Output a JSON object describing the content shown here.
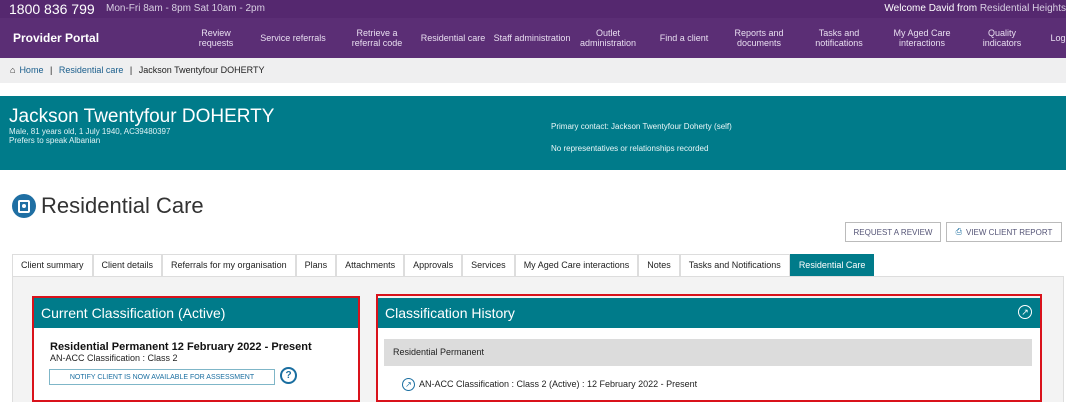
{
  "topbar": {
    "phone": "1800 836 799",
    "hours": "Mon-Fri 8am - 8pm Sat 10am - 2pm",
    "welcome_prefix": "Welcome David from",
    "welcome_org": "Residential Heights"
  },
  "nav": {
    "brand": "Provider Portal",
    "items": [
      {
        "label": "Review requests"
      },
      {
        "label": "Service referrals"
      },
      {
        "label": "Retrieve a referral code"
      },
      {
        "label": "Residential care"
      },
      {
        "label": "Staff administration"
      },
      {
        "label": "Outlet administration"
      },
      {
        "label": "Find a client"
      },
      {
        "label": "Reports and documents"
      },
      {
        "label": "Tasks and notifications"
      },
      {
        "label": "My Aged Care interactions"
      },
      {
        "label": "Quality indicators"
      },
      {
        "label": "Log"
      }
    ]
  },
  "breadcrumb": {
    "home": "Home",
    "sep": "|",
    "residential": "Residential care",
    "current": "Jackson Twentyfour DOHERTY"
  },
  "client": {
    "name": "Jackson Twentyfour DOHERTY",
    "details": "Male, 81 years old, 1 July 1940, AC39480397",
    "language": "Prefers to speak Albanian",
    "primary_contact": "Primary contact: Jackson Twentyfour Doherty (self)",
    "relationships": "No representatives or relationships recorded"
  },
  "page": {
    "title": "Residential Care",
    "request_review": "REQUEST A REVIEW",
    "view_report": "VIEW CLIENT REPORT"
  },
  "tabs": [
    {
      "label": "Client summary"
    },
    {
      "label": "Client details"
    },
    {
      "label": "Referrals for my organisation"
    },
    {
      "label": "Plans"
    },
    {
      "label": "Attachments"
    },
    {
      "label": "Approvals"
    },
    {
      "label": "Services"
    },
    {
      "label": "My Aged Care interactions"
    },
    {
      "label": "Notes"
    },
    {
      "label": "Tasks and Notifications"
    },
    {
      "label": "Residential Care"
    }
  ],
  "current_classification": {
    "heading": "Current Classification (Active)",
    "title": "Residential Permanent 12 February 2022 - Present",
    "classification": "AN-ACC Classification : Class 2",
    "notify_button": "NOTIFY CLIENT IS NOW AVAILABLE FOR ASSESSMENT",
    "help": "?"
  },
  "history": {
    "heading": "Classification History",
    "group": "Residential Permanent",
    "row": "AN-ACC Classification : Class 2 (Active) : 12 February 2022 - Present"
  },
  "colors": {
    "purple": "#5b2e75",
    "teal": "#007b8a",
    "highlight_red": "#d9121b"
  }
}
